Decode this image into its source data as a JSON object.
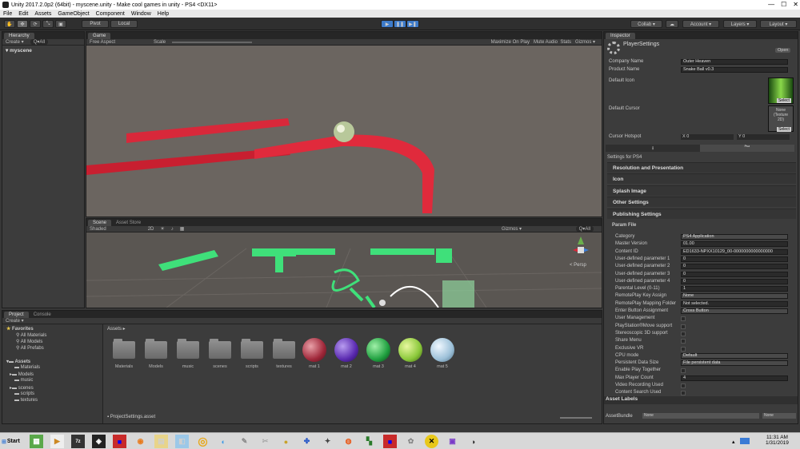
{
  "window": {
    "title": "Unity 2017.2.0p2 (64bit) - myscene.unity - Make cool games in unity - PS4 <DX11>",
    "min": "—",
    "max": "☐",
    "close": "✕"
  },
  "menu": [
    "File",
    "Edit",
    "Assets",
    "GameObject",
    "Component",
    "Window",
    "Help"
  ],
  "toolbar": {
    "pivot": "Pivot",
    "local": "Local",
    "collab": "Collab ▾",
    "account": "Account ▾",
    "layers": "Layers ▾",
    "layout": "Layout ▾"
  },
  "hierarchy": {
    "tab": "Hierarchy",
    "create": "Create ▾",
    "search": "Q▾All",
    "scene": "myscene"
  },
  "game": {
    "tab": "Game",
    "aspect": "Free Aspect",
    "scale_label": "Scale",
    "maximize": "Maximize On Play",
    "mute": "Mute Audio",
    "stats": "Stats",
    "gizmos": "Gizmos ▾"
  },
  "scene": {
    "tab": "Scene",
    "asset_store": "Asset Store",
    "shaded": "Shaded",
    "mode2d": "2D",
    "gizmos": "Gizmos ▾",
    "search": "Q▾All",
    "persp": "< Persp"
  },
  "project": {
    "tab": "Project",
    "console": "Console",
    "create": "Create ▾",
    "favorites": "Favorites",
    "fav_items": [
      "All Materials",
      "All Models",
      "All Prefabs"
    ],
    "assets_root": "Assets",
    "tree": [
      "Materials",
      "Models",
      "music",
      "scenes",
      "scripts",
      "textures"
    ],
    "breadcrumb": "Assets ▸",
    "folders": [
      "Materials",
      "Models",
      "music",
      "scenes",
      "scripts",
      "textures"
    ],
    "materials": [
      "mat 1",
      "mat 2",
      "mat 3",
      "mat 4",
      "mat 5"
    ],
    "footer": "ProjectSettings.asset"
  },
  "inspector": {
    "tab": "Inspector",
    "title": "PlayerSettings",
    "open": "Open",
    "company_label": "Company Name",
    "company": "Outer Heaven",
    "product_label": "Product Name",
    "product": "Snake Ball v0.3",
    "default_icon": "Default Icon",
    "select": "Select",
    "default_cursor": "Default Cursor",
    "none": "None\n(Texture\n2D)",
    "hotspot_label": "Cursor Hotspot",
    "hx": "X  0",
    "hy": "Y  0",
    "settings_for": "Settings for PS4",
    "sections": [
      "Resolution and Presentation",
      "Icon",
      "Splash Image",
      "Other Settings",
      "Publishing Settings"
    ],
    "param_file": "Param File",
    "rows": [
      {
        "label": "Category",
        "value": "PS4 Application",
        "type": "select"
      },
      {
        "label": "Master Version",
        "value": "01.00",
        "type": "text"
      },
      {
        "label": "Content ID",
        "value": "ED1633-NPXX10129_00-0000000000000000",
        "type": "text"
      },
      {
        "label": "User-defined parameter 1",
        "value": "0",
        "type": "text"
      },
      {
        "label": "User-defined parameter 2",
        "value": "0",
        "type": "text"
      },
      {
        "label": "User-defined parameter 3",
        "value": "0",
        "type": "text"
      },
      {
        "label": "User-defined parameter 4",
        "value": "0",
        "type": "text"
      },
      {
        "label": "Parental Level (0-11)",
        "value": "1",
        "type": "text"
      },
      {
        "label": "RemotePlay Key Assign",
        "value": "None",
        "type": "select"
      },
      {
        "label": "RemotePlay Mapping Folder",
        "value": "Not selected.",
        "type": "text"
      },
      {
        "label": "Enter Button Assignment",
        "value": "Cross Button",
        "type": "select"
      },
      {
        "label": "User Management",
        "value": "",
        "type": "check"
      },
      {
        "label": "PlayStation®Move support",
        "value": "",
        "type": "check"
      },
      {
        "label": "Stereoscopic 3D support",
        "value": "",
        "type": "check"
      },
      {
        "label": "Share Menu",
        "value": "",
        "type": "check"
      },
      {
        "label": "Exclusive VR",
        "value": "",
        "type": "check"
      },
      {
        "label": "CPU mode",
        "value": "Default",
        "type": "select"
      },
      {
        "label": "Persistent Data Size",
        "value": "File persistent data",
        "type": "select"
      },
      {
        "label": "Enable Play Together",
        "value": "",
        "type": "check"
      },
      {
        "label": "Max Player Count",
        "value": "4",
        "type": "text"
      },
      {
        "label": "Video Recording Used",
        "value": "",
        "type": "check"
      },
      {
        "label": "Content Search Used",
        "value": "",
        "type": "check"
      }
    ],
    "asset_labels": "Asset Labels",
    "asset_bundle": "AssetBundle",
    "bundle_val": "None",
    "bundle_val2": "None"
  },
  "taskbar": {
    "start": "Start",
    "time": "11:31 AM",
    "date": "1/31/2019"
  }
}
